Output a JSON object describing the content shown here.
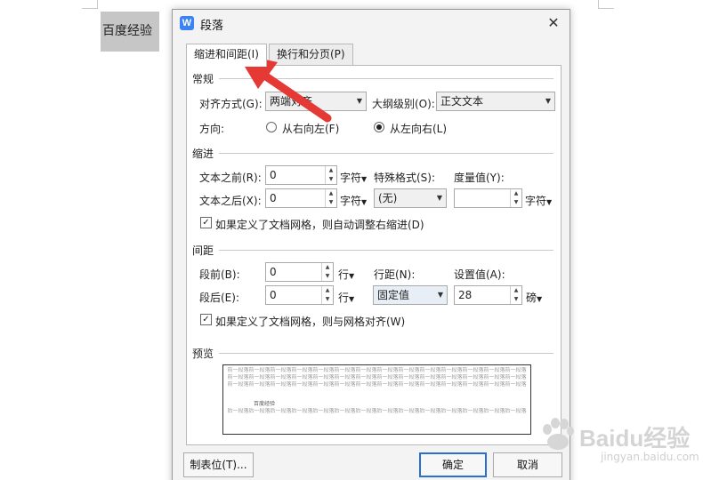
{
  "document": {
    "text": "百度经验"
  },
  "dialog": {
    "title": "段落",
    "app_icon_letter": "W",
    "close_glyph": "✕",
    "tabs": [
      {
        "label": "缩进和间距(I)",
        "active": true
      },
      {
        "label": "换行和分页(P)",
        "active": false
      }
    ],
    "general": {
      "title": "常规",
      "alignment_label": "对齐方式(G):",
      "alignment_value": "两端对齐",
      "outline_label": "大纲级别(O):",
      "outline_value": "正文文本",
      "direction_label": "方向:",
      "direction_rtl": "从右向左(F)",
      "direction_ltr": "从左向右(L)",
      "direction_selected": "ltr"
    },
    "indent": {
      "title": "缩进",
      "before_label": "文本之前(R):",
      "before_value": "0",
      "before_unit": "字符",
      "after_label": "文本之后(X):",
      "after_value": "0",
      "after_unit": "字符",
      "special_label": "特殊格式(S):",
      "special_value": "(无)",
      "measure_label": "度量值(Y):",
      "measure_value": "",
      "measure_unit": "字符",
      "auto_adjust_label": "如果定义了文档网格，则自动调整右缩进(D)",
      "auto_adjust_checked": true
    },
    "spacing": {
      "title": "间距",
      "before_label": "段前(B):",
      "before_value": "0",
      "before_unit": "行",
      "after_label": "段后(E):",
      "after_value": "0",
      "after_unit": "行",
      "line_label": "行距(N):",
      "line_value": "固定值",
      "setting_label": "设置值(A):",
      "setting_value": "28",
      "setting_unit": "磅",
      "grid_align_label": "如果定义了文档网格，则与网格对齐(W)",
      "grid_align_checked": true
    },
    "preview": {
      "title": "预览",
      "prev_line": "前一段落前一段落前一段落前一段落前一段落前一段落前一段落前一段落前一段落前一段落前一段落前一段落前一段落前一段落",
      "body_text": "百度经验",
      "next_line": "后一段落后一段落后一段落后一段落后一段落后一段落后一段落后一段落后一段落后一段落后一段落后一段落后一段落后一段落"
    },
    "buttons": {
      "tabs_label": "制表位(T)...",
      "ok_label": "确定",
      "cancel_label": "取消"
    }
  },
  "annotation": {
    "color": "#e53935"
  },
  "watermark": {
    "main": "Baidu经验",
    "sub": "jingyan.baidu.com"
  }
}
